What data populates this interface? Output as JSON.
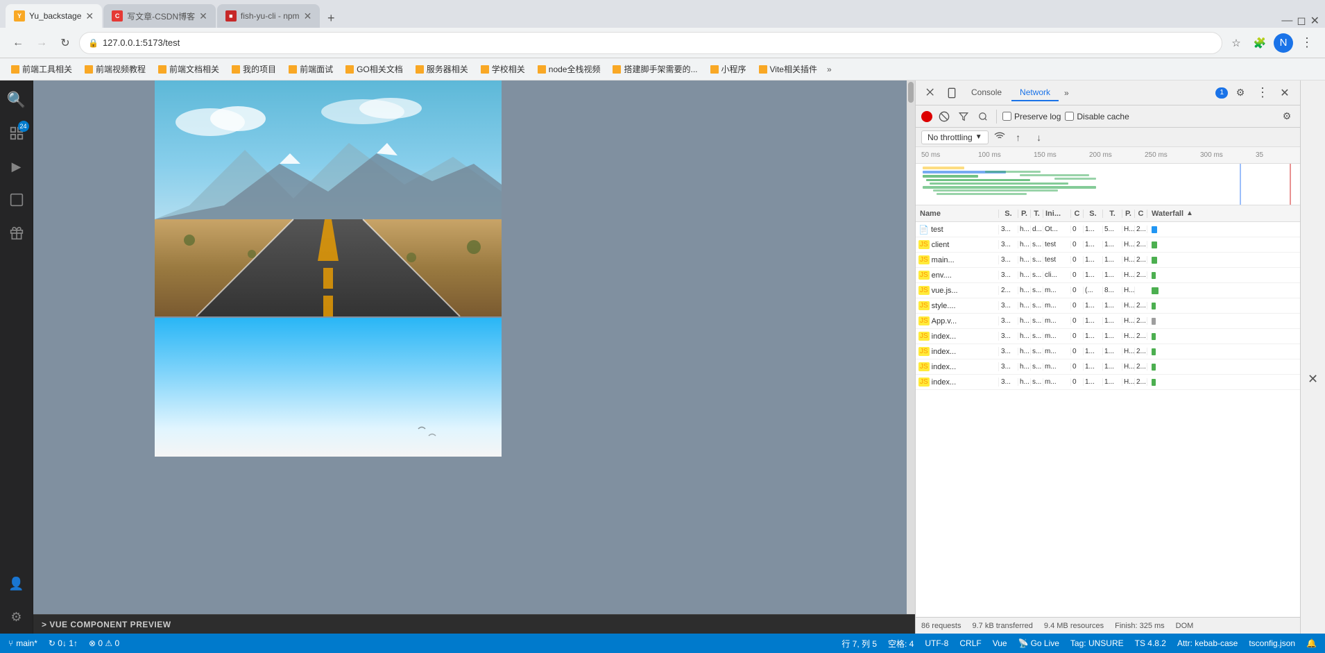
{
  "browser": {
    "tabs": [
      {
        "id": "tab1",
        "favicon": "🟨",
        "title": "Yu_backstage",
        "active": true,
        "favicon_color": "#f9a825"
      },
      {
        "id": "tab2",
        "favicon": "C",
        "title": "写文章-CSDN博客",
        "active": false,
        "favicon_color": "#e53935"
      },
      {
        "id": "tab3",
        "favicon": "⬛",
        "title": "fish-yu-cli - npm",
        "active": false,
        "favicon_color": "#c62828"
      }
    ],
    "url": "127.0.0.1:5173/test",
    "bookmarks": [
      {
        "label": "前端工具相关"
      },
      {
        "label": "前端视频教程"
      },
      {
        "label": "前端文档相关"
      },
      {
        "label": "我的项目"
      },
      {
        "label": "前端面试"
      },
      {
        "label": "GO相关文档"
      },
      {
        "label": "服务器相关"
      },
      {
        "label": "学校相关"
      },
      {
        "label": "node全栈视频"
      },
      {
        "label": "搭建脚手架需要的..."
      },
      {
        "label": "小程序"
      },
      {
        "label": "Vite相关插件"
      }
    ]
  },
  "vscode_sidebar": {
    "icons": [
      {
        "name": "search-icon",
        "symbol": "🔍",
        "active": false
      },
      {
        "name": "explorer-icon",
        "symbol": "📁",
        "active": false,
        "badge": "24"
      },
      {
        "name": "run-icon",
        "symbol": "▶",
        "active": false
      },
      {
        "name": "debug-icon",
        "symbol": "🐛",
        "active": false
      },
      {
        "name": "extensions-icon",
        "symbol": "⬛",
        "active": false
      }
    ],
    "bottom_icons": [
      {
        "name": "account-icon",
        "symbol": "👤"
      },
      {
        "name": "settings-icon",
        "symbol": "⚙"
      }
    ]
  },
  "devtools": {
    "tabs": [
      {
        "label": "Console",
        "active": false
      },
      {
        "label": "Network",
        "active": true
      }
    ],
    "more_label": "»",
    "badge": "1",
    "toolbar": {
      "preserve_log_label": "Preserve log",
      "disable_cache_label": "Disable cache",
      "no_throttling_label": "No throttling"
    },
    "timeline": {
      "marks": [
        "50 ms",
        "100 ms",
        "150 ms",
        "200 ms",
        "250 ms",
        "300 ms",
        "35"
      ]
    },
    "table": {
      "headers": [
        "Name",
        "S.",
        "P.",
        "T.",
        "Ini...",
        "C",
        "S.",
        "T.",
        "P.",
        "C.",
        "Waterfall"
      ],
      "rows": [
        {
          "name": "test",
          "col1": "3...",
          "col2": "h...",
          "col3": "d...",
          "col4": "Ot...",
          "col5": "0",
          "col6": "1...",
          "col7": "5...",
          "col8": "H...",
          "col9": "2...",
          "type": "doc",
          "waterfall_color": "#2196f3",
          "waterfall_width": 8
        },
        {
          "name": "client",
          "col1": "3...",
          "col2": "h...",
          "col3": "s...",
          "col4": "test",
          "col5": "0",
          "col6": "1...",
          "col7": "1...",
          "col8": "H...",
          "col9": "2...",
          "type": "js",
          "waterfall_color": "#4caf50",
          "waterfall_width": 8
        },
        {
          "name": "main...",
          "col1": "3...",
          "col2": "h...",
          "col3": "s...",
          "col4": "test",
          "col5": "0",
          "col6": "1...",
          "col7": "1...",
          "col8": "H...",
          "col9": "2...",
          "type": "js",
          "waterfall_color": "#4caf50",
          "waterfall_width": 8
        },
        {
          "name": "env....",
          "col1": "3...",
          "col2": "h...",
          "col3": "s...",
          "col4": "cli...",
          "col5": "0",
          "col6": "1...",
          "col7": "1...",
          "col8": "H...",
          "col9": "2...",
          "type": "js",
          "waterfall_color": "#4caf50",
          "waterfall_width": 6
        },
        {
          "name": "vue.js...",
          "col1": "2...",
          "col2": "h...",
          "col3": "s...",
          "col4": "m...",
          "col5": "0",
          "col6": "(...",
          "col7": "8...",
          "col8": "H...",
          "col9": "",
          "type": "js",
          "waterfall_color": "#4caf50",
          "waterfall_width": 6
        },
        {
          "name": "style....",
          "col1": "3...",
          "col2": "h...",
          "col3": "s...",
          "col4": "m...",
          "col5": "0",
          "col6": "1...",
          "col7": "1...",
          "col8": "H...",
          "col9": "2...",
          "type": "js",
          "waterfall_color": "#4caf50",
          "waterfall_width": 6
        },
        {
          "name": "App.v...",
          "col1": "3...",
          "col2": "h...",
          "col3": "s...",
          "col4": "m...",
          "col5": "0",
          "col6": "1...",
          "col7": "1...",
          "col8": "H...",
          "col9": "2...",
          "type": "js",
          "waterfall_color": "#888",
          "waterfall_width": 6
        },
        {
          "name": "index...",
          "col1": "3...",
          "col2": "h...",
          "col3": "s...",
          "col4": "m...",
          "col5": "0",
          "col6": "1...",
          "col7": "1...",
          "col8": "H...",
          "col9": "2...",
          "type": "js",
          "waterfall_color": "#4caf50",
          "waterfall_width": 6
        },
        {
          "name": "index...",
          "col1": "3...",
          "col2": "h...",
          "col3": "s...",
          "col4": "m...",
          "col5": "0",
          "col6": "1...",
          "col7": "1...",
          "col8": "H...",
          "col9": "2...",
          "type": "js",
          "waterfall_color": "#4caf50",
          "waterfall_width": 6
        },
        {
          "name": "index...",
          "col1": "3...",
          "col2": "h...",
          "col3": "s...",
          "col4": "m...",
          "col5": "0",
          "col6": "1...",
          "col7": "1...",
          "col8": "H...",
          "col9": "2...",
          "type": "js",
          "waterfall_color": "#4caf50",
          "waterfall_width": 6
        },
        {
          "name": "index...",
          "col1": "3...",
          "col2": "h...",
          "col3": "s...",
          "col4": "m...",
          "col5": "0",
          "col6": "1...",
          "col7": "1...",
          "col8": "H...",
          "col9": "2...",
          "type": "js",
          "waterfall_color": "#4caf50",
          "waterfall_width": 6
        }
      ]
    },
    "status": {
      "requests": "86 requests",
      "transferred": "9.7 kB transferred",
      "resources": "9.4 MB resources",
      "finish": "Finish: 325 ms",
      "dom": "DOM"
    }
  },
  "status_bar": {
    "branch": "main*",
    "sync": "↻ 0↓ 1↑",
    "errors": "⊗ 0 ⚠ 0",
    "line": "行 7, 列 5",
    "spaces": "空格: 4",
    "encoding": "UTF-8",
    "eol": "CRLF",
    "language": "Vue",
    "go_live": "Go Live",
    "tag": "Tag: UNSURE",
    "ts": "TS 4.8.2",
    "attr": "Attr: kebab-case",
    "tsconfig": "tsconfig.json"
  },
  "vue_preview": {
    "bottom_bar": {
      "label": "> VUE COMPONENT PREVIEW"
    }
  }
}
